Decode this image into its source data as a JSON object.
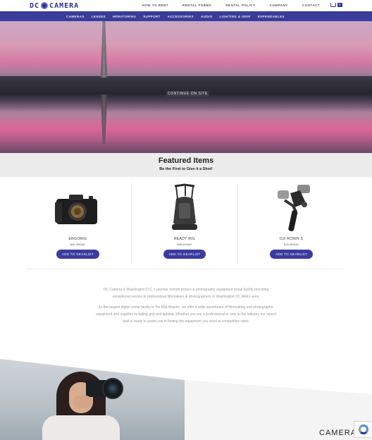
{
  "brand": {
    "logo_text_left": "DC",
    "logo_text_right": "CAMERA"
  },
  "top_nav": [
    "HOW TO RENT",
    "RENTAL FORMS",
    "RENTAL POLICY",
    "COMPANY",
    "CONTACT"
  ],
  "cart": {
    "count": "0"
  },
  "sub_nav": [
    "CAMERAS",
    "LENSES",
    "MONITORING",
    "SUPPORT",
    "ACCESSORIES",
    "AUDIO",
    "LIGHTING & GRIP",
    "EXPENDABLES"
  ],
  "hero": {
    "cta": "CONTINUE ON SITE"
  },
  "featured": {
    "title": "Featured Items",
    "subtitle": "Be the First to Give it a Shot!"
  },
  "products": [
    {
      "name": "ERGORIG",
      "price": "$40.00/DAY",
      "button": "ADD TO GEARLIST"
    },
    {
      "name": "READY RIG",
      "price": "$40.00/DAY",
      "button": "ADD TO GEARLIST"
    },
    {
      "name": "DJI RONIN S",
      "price": "$75.00/DAY",
      "button": "ADD TO GEARLIST"
    }
  ],
  "about": {
    "p1": "DC Camera is Washington D.C.'s premier motion picture & photography equipment rental facility providing exceptional service to professional filmmakers & photographers in Washington DC Metro area.",
    "p2": "As the largest digital rental facility in the Mid-Atlantic, we offer a wide assortment of filmmaking and photographic equipment and supplies including grip and lighting. Whether you are a professional or new to the industry our expert staff is ready to assist you in finding the equipment you need at competitive rates."
  },
  "bottom": {
    "heading": "CAMERA"
  }
}
